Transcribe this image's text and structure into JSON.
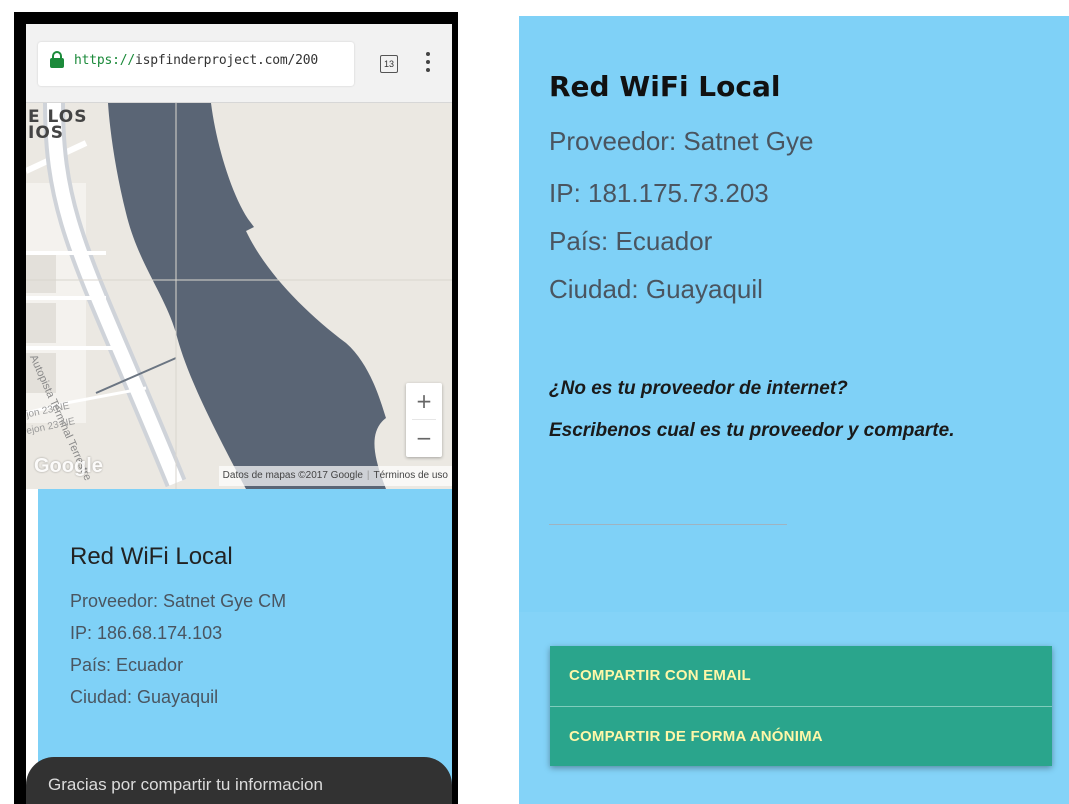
{
  "phone": {
    "browser": {
      "url_scheme": "https://",
      "url_rest": "ispfinderproject.com/200",
      "tab_count": "13"
    },
    "map": {
      "labels": {
        "neighborhood_1": "E LOS",
        "neighborhood_2": "IOS",
        "street_1": "Autopista Terminal Terrestre",
        "street_2": "jon 23 NE",
        "street_3": "ejon 23 NE"
      },
      "zoom_in": "+",
      "zoom_out": "−",
      "logo": "Google",
      "attribution": "Datos de mapas ©2017 Google",
      "terms": "Términos de uso"
    },
    "card": {
      "title": "Red WiFi Local",
      "provider": "Proveedor: Satnet Gye CM",
      "ip": "IP: 186.68.174.103",
      "country": "País: Ecuador",
      "city": "Ciudad: Guayaquil"
    },
    "snackbar": "Gracias por compartir tu informacion"
  },
  "panel": {
    "title": "Red WiFi Local",
    "provider": "Proveedor: Satnet Gye",
    "ip": "IP: 181.175.73.203",
    "country": "País: Ecuador",
    "city": "Ciudad: Guayaquil",
    "question": "¿No es tu proveedor de internet?",
    "prompt": "Escribenos cual es tu proveedor y comparte.",
    "share_email": "COMPARTIR CON EMAIL",
    "share_anonymous": "COMPARTIR DE FORMA ANÓNIMA"
  },
  "colors": {
    "card_bg": "#7fd1f7",
    "button_bg": "#2aa58c",
    "button_text": "#fff7a8",
    "river": "#5a6575",
    "snackbar": "#323232"
  }
}
